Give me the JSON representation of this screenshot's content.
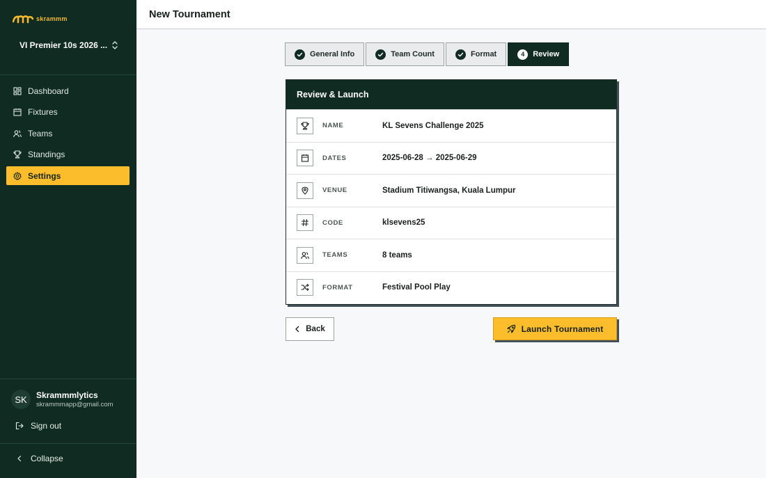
{
  "brand": {
    "name": "skrammm",
    "accent": "#fbbd2c",
    "sidebar_bg": "#0f2b22"
  },
  "workspace": {
    "name": "VI Premier 10s 2026 ...",
    "icon": "chevron-up-down-icon"
  },
  "nav": {
    "items": [
      {
        "label": "Dashboard",
        "icon": "dashboard-icon"
      },
      {
        "label": "Fixtures",
        "icon": "calendar-icon"
      },
      {
        "label": "Teams",
        "icon": "users-icon"
      },
      {
        "label": "Standings",
        "icon": "trophy-icon"
      },
      {
        "label": "Settings",
        "icon": "gear-icon",
        "active": true
      }
    ]
  },
  "user": {
    "initials": "SK",
    "name": "Skrammmlytics",
    "email": "skrammmapp@gmail.com"
  },
  "sidebar_actions": {
    "sign_out": "Sign out",
    "collapse": "Collapse"
  },
  "header": {
    "title": "New Tournament"
  },
  "stepper": {
    "steps": [
      {
        "label": "General Info",
        "state": "done"
      },
      {
        "label": "Team Count",
        "state": "done"
      },
      {
        "label": "Format",
        "state": "done"
      },
      {
        "number": "4",
        "label": "Review",
        "state": "current"
      }
    ]
  },
  "review": {
    "title": "Review & Launch",
    "rows": [
      {
        "label": "NAME",
        "value": "KL Sevens Challenge 2025",
        "icon": "trophy-icon"
      },
      {
        "label": "DATES",
        "value": "2025-06-28 → 2025-06-29",
        "icon": "calendar-icon"
      },
      {
        "label": "VENUE",
        "value": "Stadium Titiwangsa, Kuala Lumpur",
        "icon": "map-pin-icon"
      },
      {
        "label": "CODE",
        "value": "klsevens25",
        "icon": "hash-icon"
      },
      {
        "label": "TEAMS",
        "value": "8 teams",
        "icon": "users-icon"
      },
      {
        "label": "FORMAT",
        "value": "Festival Pool Play",
        "icon": "shuffle-icon"
      }
    ]
  },
  "actions": {
    "back": "Back",
    "launch": "Launch Tournament"
  }
}
